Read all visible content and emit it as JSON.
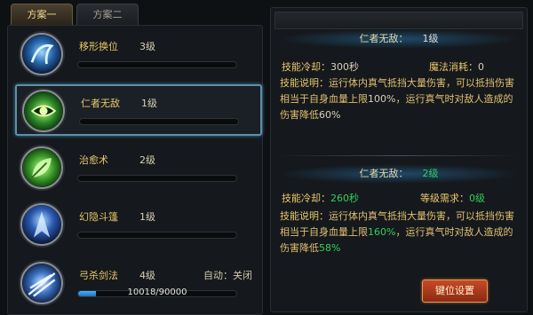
{
  "tabs": [
    {
      "label": "方案一",
      "active": true
    },
    {
      "label": "方案二",
      "active": false
    }
  ],
  "skills": [
    {
      "name": "移形换位",
      "level": "3级",
      "icon": "teleport-icon",
      "selected": false
    },
    {
      "name": "仁者无敌",
      "level": "1级",
      "icon": "invincible-eye-icon",
      "selected": true
    },
    {
      "name": "治愈术",
      "level": "2级",
      "icon": "heal-leaf-icon",
      "selected": false
    },
    {
      "name": "幻隐斗篷",
      "level": "1级",
      "icon": "cloak-icon",
      "selected": false
    },
    {
      "name": "弓杀剑法",
      "level": "4级",
      "icon": "sword-slash-icon",
      "selected": false,
      "auto": "自动：关闭",
      "exp": "10018/90000",
      "exp_fraction": 0.11
    }
  ],
  "current": {
    "name": "仁者无敌：",
    "level": "1级",
    "cooldown_label": "技能冷却：",
    "cooldown_value": "300秒",
    "mana_label": "魔法消耗：",
    "mana_value": "0",
    "desc_label": "技能说明：",
    "desc_parts": [
      "运行体内真气抵挡大量伤害，可以抵挡伤害相当于自身血量上限",
      "100%",
      "，运行真气时对敌人造成的伤害降低",
      "60%"
    ]
  },
  "next": {
    "name": "仁者无敌：",
    "level": "2级",
    "cooldown_label": "技能冷却：",
    "cooldown_value": "260秒",
    "req_label": "等级需求：",
    "req_value": "0级",
    "desc_label": "技能说明：",
    "desc_parts": [
      "运行体内真气抵挡大量伤害，可以抵挡伤害相当于自身血量上限",
      "160%",
      "，运行真气时对敌人造成的伤害降低",
      "58%"
    ]
  },
  "key_button": "键位设置",
  "colors": {
    "accent_gold": "#e8c86a",
    "upgrade_green": "#33d05a",
    "exp_blue": "#4ab0ff",
    "button_red": "#c84a28"
  }
}
